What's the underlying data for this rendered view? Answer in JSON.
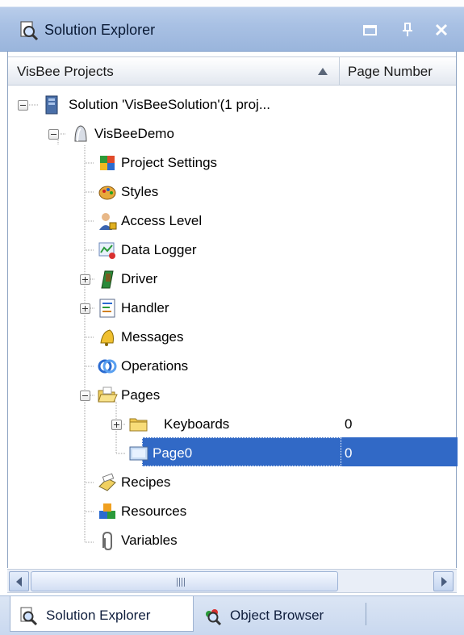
{
  "window": {
    "title": "Solution Explorer"
  },
  "columns": {
    "name": "VisBee Projects",
    "page_number": "Page Number"
  },
  "tree": {
    "solution": "Solution 'VisBeeSolution'(1 proj...",
    "project": "VisBeeDemo",
    "items": [
      {
        "label": "Project Settings",
        "icon": "project-settings-icon"
      },
      {
        "label": "Styles",
        "icon": "styles-palette-icon"
      },
      {
        "label": "Access Level",
        "icon": "user-lock-icon"
      },
      {
        "label": "Data Logger",
        "icon": "data-logger-icon"
      },
      {
        "label": "Driver",
        "icon": "driver-icon",
        "expandable": true
      },
      {
        "label": "Handler",
        "icon": "handler-list-icon",
        "expandable": true
      },
      {
        "label": "Messages",
        "icon": "bell-icon"
      },
      {
        "label": "Operations",
        "icon": "operations-rings-icon"
      },
      {
        "label": "Pages",
        "icon": "folder-open-icon",
        "expanded": true
      },
      {
        "label": "Recipes",
        "icon": "recipes-icon"
      },
      {
        "label": "Resources",
        "icon": "resources-blocks-icon"
      },
      {
        "label": "Variables",
        "icon": "variables-clip-icon"
      }
    ],
    "pages": [
      {
        "label": "Keyboards",
        "page_number": "0",
        "icon": "folder-icon",
        "expandable": true
      },
      {
        "label": "Page0",
        "page_number": "0",
        "icon": "page-screen-icon",
        "selected": true
      }
    ]
  },
  "tabs": [
    {
      "label": "Solution Explorer",
      "active": true
    },
    {
      "label": "Object Browser",
      "active": false
    }
  ],
  "colors": {
    "selection": "#3169c6",
    "titlebar": "#a9c1e4"
  }
}
